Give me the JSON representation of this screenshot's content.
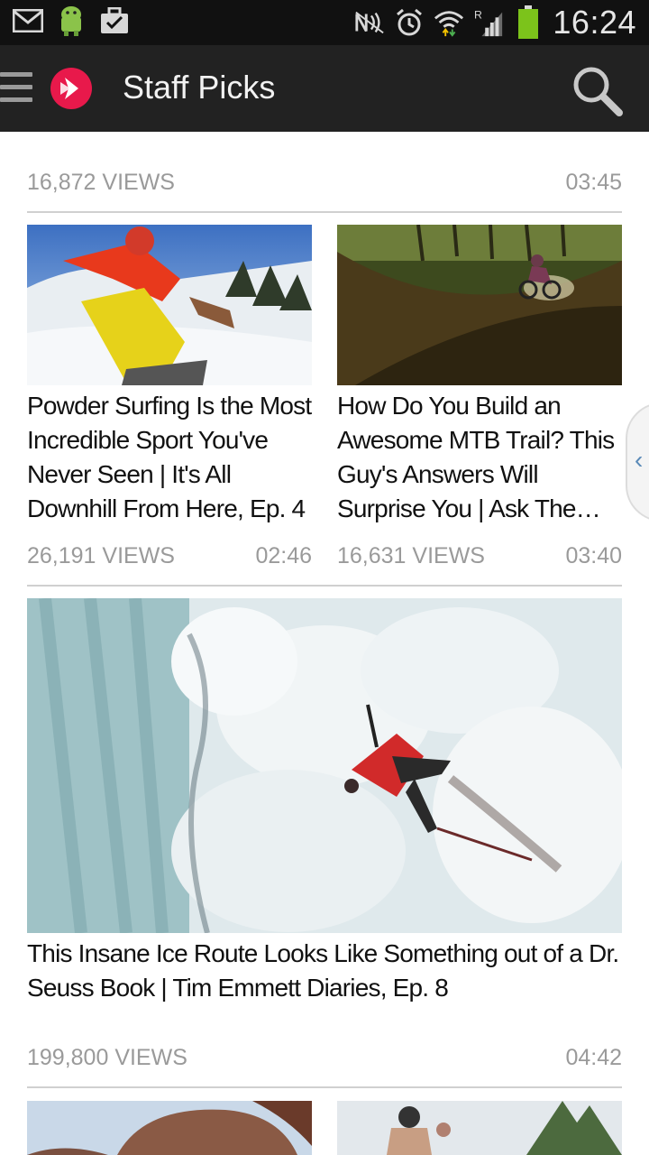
{
  "status_bar": {
    "time": "16:24",
    "left_icons": [
      "gmail-icon",
      "android-icon",
      "briefcase-icon"
    ],
    "right_icons": [
      "nfc-icon",
      "alarm-icon",
      "wifi-icon",
      "signal-icon",
      "battery-icon"
    ]
  },
  "app_bar": {
    "title": "Staff Picks"
  },
  "feed": {
    "top_meta": {
      "views": "16,872 VIEWS",
      "duration": "03:45"
    },
    "cards": [
      {
        "title": "Powder Surfing Is the Most Incredible Sport You've Never Seen | It's All Downhill From Here, Ep. 4",
        "views": "26,191 VIEWS",
        "duration": "02:46"
      },
      {
        "title": "How Do You Build an Awesome MTB Trail? This Guy's Answers Will Surprise You | Ask The…",
        "views": "16,631 VIEWS",
        "duration": "03:40"
      }
    ],
    "featured": {
      "title": "This Insane Ice Route Looks Like Something out of a Dr. Seuss Book | Tim Emmett Diaries, Ep. 8",
      "views": "199,800 VIEWS",
      "duration": "04:42"
    }
  },
  "colors": {
    "status_bar_bg": "#111111",
    "app_bar_bg": "#222222",
    "brand_red": "#e8194b",
    "meta_text": "#9a9a9a"
  }
}
